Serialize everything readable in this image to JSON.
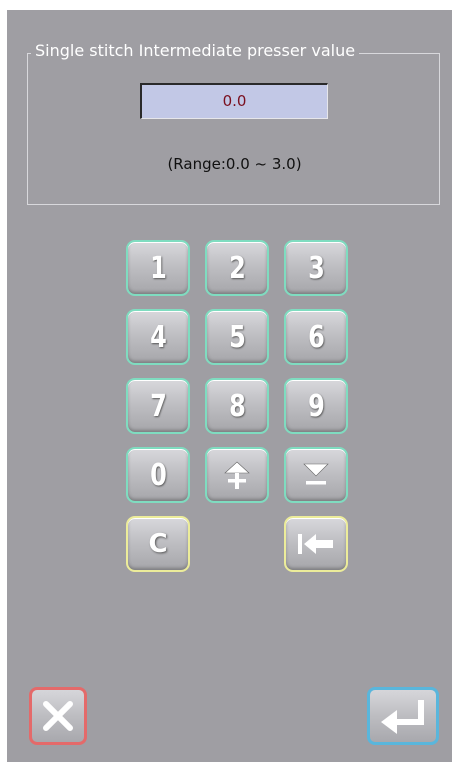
{
  "dialog": {
    "group_title": "Single stitch Intermediate presser value",
    "value": "0.0",
    "range_text": "(Range:0.0 ~ 3.0)"
  },
  "keypad": {
    "keys": [
      "1",
      "2",
      "3",
      "4",
      "5",
      "6",
      "7",
      "8",
      "9",
      "0"
    ],
    "increase_icon": "up-arrow-plus-icon",
    "decrease_icon": "down-arrow-minus-icon",
    "clear_label": "C",
    "backspace_icon": "backspace-arrow-icon"
  },
  "footer": {
    "cancel_icon": "close-x-icon",
    "confirm_icon": "enter-return-icon"
  },
  "colors": {
    "background": "#9f9ea3",
    "value_fill": "#c2c8e6",
    "value_text": "#7a0f1e",
    "key_border": "#7fdcc0",
    "special_key_border": "#ecec9a",
    "cancel_border": "#e46a6a",
    "confirm_border": "#59b6dc"
  }
}
